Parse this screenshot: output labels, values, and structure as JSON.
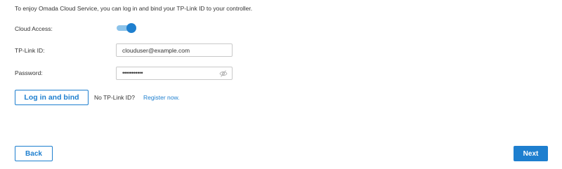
{
  "intro_text": "To enjoy Omada Cloud Service, you can log in and bind your TP-Link ID to your controller.",
  "cloud_access": {
    "label": "Cloud Access:",
    "enabled": true
  },
  "tplink_id": {
    "label": "TP-Link ID:",
    "value": "clouduser@example.com"
  },
  "password": {
    "label": "Password:",
    "masked_value": "•••••••••••",
    "visibility_icon": "eye-slash-icon"
  },
  "actions": {
    "login_bind_label": "Log in and bind",
    "no_id_text": "No TP-Link ID?",
    "register_link": "Register now."
  },
  "footer": {
    "back_label": "Back",
    "next_label": "Next"
  },
  "colors": {
    "accent": "#1e7fcf",
    "toggle_track": "#8cc3ea"
  }
}
